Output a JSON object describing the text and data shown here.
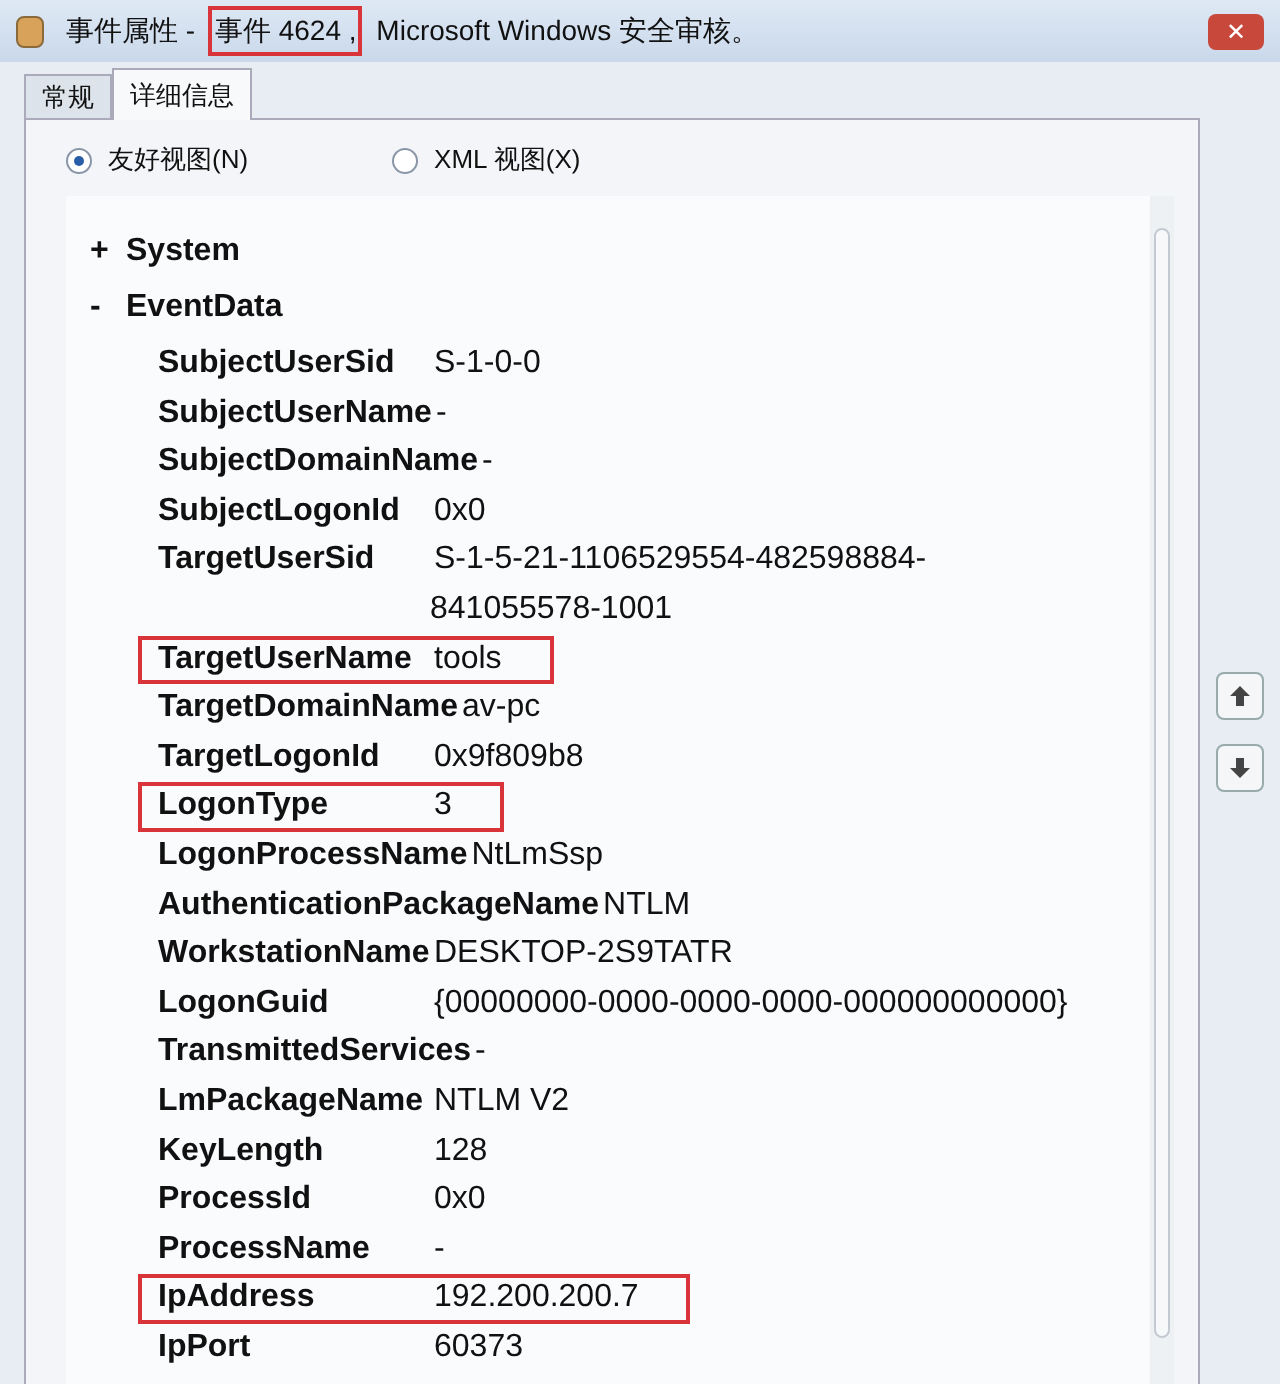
{
  "window": {
    "close_glyph": "✕",
    "title_segments": [
      {
        "text": "事件属性 - ",
        "highlighted": false
      },
      {
        "text": "事件 4624 ,",
        "highlighted": true
      },
      {
        "text": " Microsoft Windows 安全审核。",
        "highlighted": false
      }
    ]
  },
  "tabs": [
    {
      "label": "常规",
      "selected": false
    },
    {
      "label": "详细信息",
      "selected": true
    }
  ],
  "views": [
    {
      "label": "友好视图(N)",
      "selected": true
    },
    {
      "label": "XML 视图(X)",
      "selected": false
    }
  ],
  "tree": [
    {
      "toggle": "+",
      "label": "System"
    },
    {
      "toggle": "-",
      "label": "EventData",
      "children": [
        {
          "name": "SubjectUserSid",
          "value": "S-1-0-0",
          "highlighted": false
        },
        {
          "name": "SubjectUserName",
          "value": "-",
          "highlighted": false
        },
        {
          "name": "SubjectDomainName",
          "value": "-",
          "highlighted": false
        },
        {
          "name": "SubjectLogonId",
          "value": "0x0",
          "highlighted": false
        },
        {
          "name": "TargetUserSid",
          "value": "S-1-5-21-1106529554-482598884-",
          "value_continued": "841055578-1001",
          "highlighted": false
        },
        {
          "name": "TargetUserName",
          "value": "tools",
          "highlighted": true
        },
        {
          "name": "TargetDomainName",
          "value": "av-pc",
          "highlighted": false
        },
        {
          "name": "TargetLogonId",
          "value": "0x9f809b8",
          "highlighted": false
        },
        {
          "name": "LogonType",
          "value": "3",
          "highlighted": true
        },
        {
          "name": "LogonProcessName",
          "value": "NtLmSsp",
          "highlighted": false
        },
        {
          "name": "AuthenticationPackageName",
          "value": "NTLM",
          "highlighted": false
        },
        {
          "name": "WorkstationName",
          "value": "DESKTOP-2S9TATR",
          "highlighted": false
        },
        {
          "name": "LogonGuid",
          "value": "{00000000-0000-0000-0000-000000000000}",
          "highlighted": false
        },
        {
          "name": "TransmittedServices",
          "value": "-",
          "highlighted": false
        },
        {
          "name": "LmPackageName",
          "value": "NTLM V2",
          "highlighted": false
        },
        {
          "name": "KeyLength",
          "value": "128",
          "highlighted": false
        },
        {
          "name": "ProcessId",
          "value": "0x0",
          "highlighted": false
        },
        {
          "name": "ProcessName",
          "value": "-",
          "highlighted": false
        },
        {
          "name": "IpAddress",
          "value": "192.200.200.7",
          "highlighted": true
        },
        {
          "name": "IpPort",
          "value": "60373",
          "highlighted": false
        }
      ]
    }
  ]
}
